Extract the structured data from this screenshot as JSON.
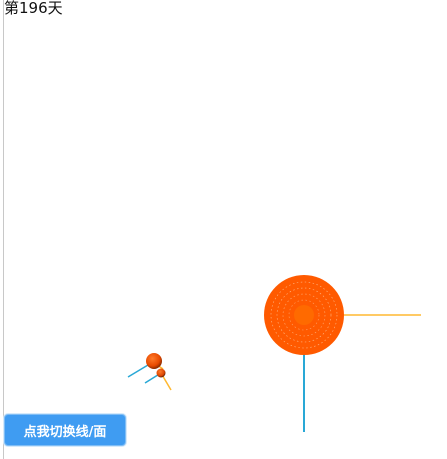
{
  "day_counter": "第196天",
  "toggle_button_label": "点我切换线/面",
  "colors": {
    "sun": "#ff5a00",
    "sun_core": "#ff6a00",
    "sun_mesh": "#ffd2a8",
    "planet": "#e84a00",
    "axis_blue": "#29a8d6",
    "axis_yellow": "#ffb830",
    "button_bg": "#3f9cf2",
    "button_text": "#ffffff"
  }
}
